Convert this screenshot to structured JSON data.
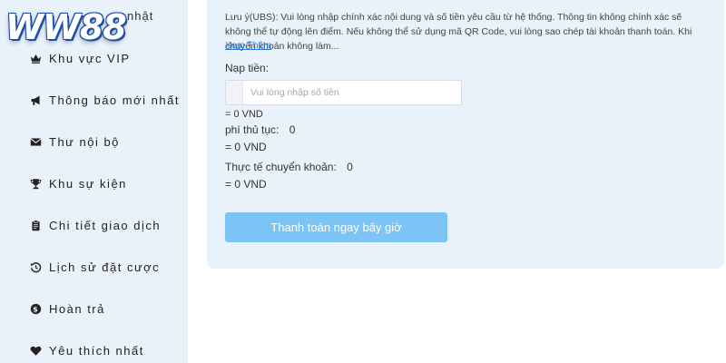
{
  "logo": {
    "text": "WW88"
  },
  "sidebar": {
    "partial_item": "nhật",
    "items": [
      {
        "label": "Khu vực VIP",
        "icon": "crown-icon"
      },
      {
        "label": "Thông báo mới nhất",
        "icon": "megaphone-icon"
      },
      {
        "label": "Thư nội bộ",
        "icon": "envelope-icon"
      },
      {
        "label": "Khu sự kiện",
        "icon": "trophy-icon"
      },
      {
        "label": "Chi tiết giao dịch",
        "icon": "clipboard-icon"
      },
      {
        "label": "Lịch sử đặt cược",
        "icon": "history-icon"
      },
      {
        "label": "Hoàn trả",
        "icon": "dollar-coin-icon"
      },
      {
        "label": "Yêu thích nhất",
        "icon": "heart-icon"
      }
    ]
  },
  "deposit": {
    "notice": "Lưu ý(UBS): Vui lòng nhập chính xác nội dung và số tiền yêu cầu từ hệ thống. Thông tin không chính xác sẽ không thể tự động lên điểm. Nếu không thể sử dụng mã QR Code, vui lòng sao chép tài khoản thanh toán. Khi chuyển khoản không làm...",
    "see_more": "Xem Thêm",
    "amount_label": "Nạp tiền:",
    "amount_placeholder": "Vui lòng nhập số tiền",
    "amount_value": "",
    "amount_converted": "= 0 VND",
    "fee_label": "phí thủ tục:",
    "fee_value": "0",
    "fee_converted": "= 0 VND",
    "actual_label": "Thực tế chuyển khoản:",
    "actual_value": "0",
    "actual_converted": "= 0 VND",
    "pay_button": "Thanh toán ngay bây giờ"
  },
  "colors": {
    "panel_bg": "#e9f1fb",
    "button_bg": "#7cc4f5",
    "link": "#2a7de1"
  }
}
